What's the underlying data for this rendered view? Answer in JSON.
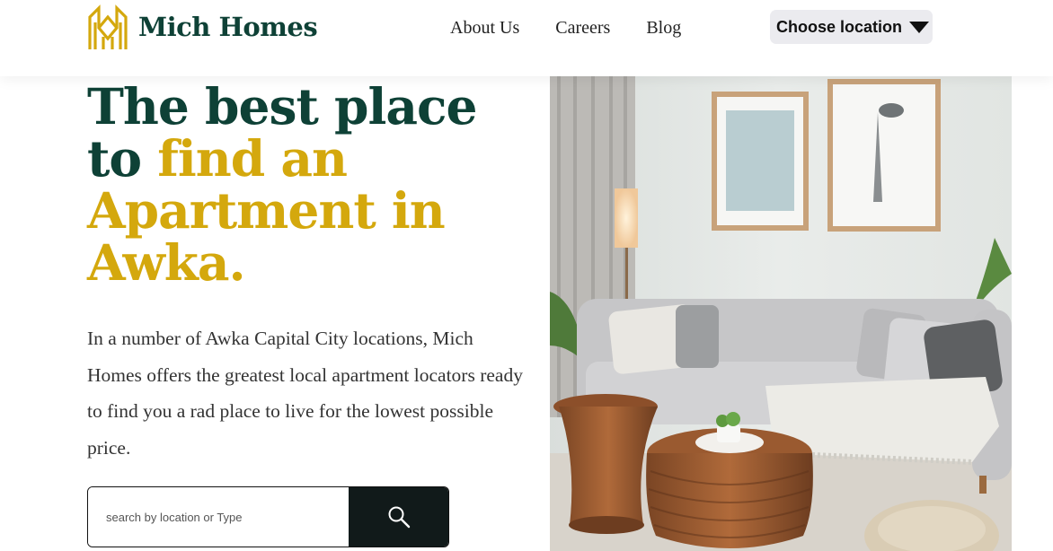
{
  "header": {
    "brand_name": "Mich Homes",
    "nav": [
      {
        "label": "About Us"
      },
      {
        "label": "Careers"
      },
      {
        "label": "Blog"
      }
    ],
    "location_button": "Choose location"
  },
  "hero": {
    "title_line1": "The best place",
    "title_to": "to ",
    "title_highlight1": "find an",
    "title_highlight2": "Apartment in",
    "title_highlight3": "Awka.",
    "description": "In a number of Awka Capital City locations, Mich Homes offers the greatest local apartment locators ready to find you a rad place to live for the lowest possible price.",
    "search_placeholder": "search by location or Type"
  },
  "colors": {
    "brand_dark": "#0e4136",
    "brand_gold": "#d4a80d",
    "search_button": "#111a1a",
    "location_button_bg": "#ebebef"
  },
  "icons": {
    "logo": "mich-homes-logo",
    "location_caret": "caret-down-icon",
    "search": "search-icon"
  }
}
